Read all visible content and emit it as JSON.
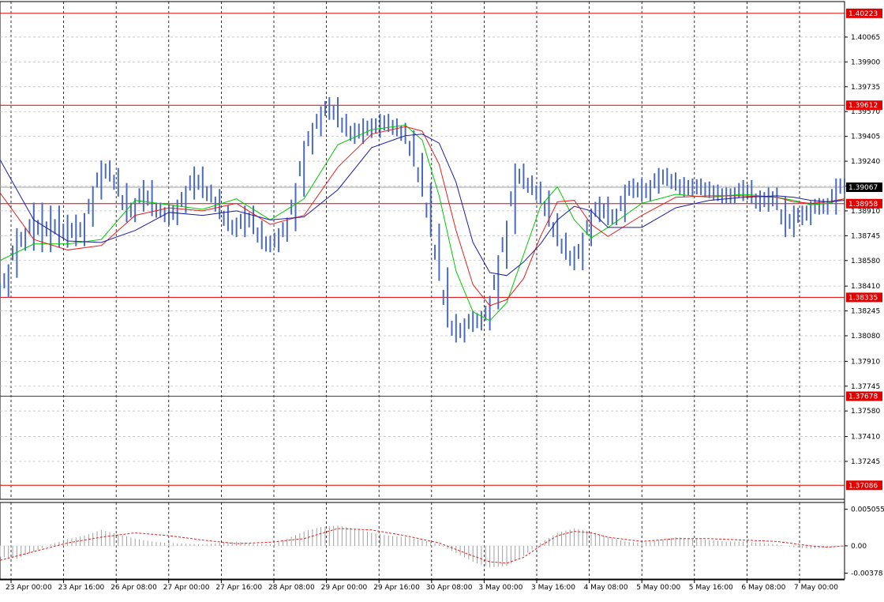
{
  "chart_data": {
    "type": "line",
    "main_panel": {
      "ylim": [
        1.36993,
        1.40301
      ],
      "y_ticks": [
        "1.40065",
        "1.39900",
        "1.39735",
        "1.39570",
        "1.39405",
        "1.39240",
        "1.39075",
        "1.38910",
        "1.38745",
        "1.38580",
        "1.38410",
        "1.38245",
        "1.38080",
        "1.37910",
        "1.37745",
        "1.37580",
        "1.37410",
        "1.37245"
      ],
      "current_price": "1.39067",
      "horizontal_levels": [
        "1.40223",
        "1.39612",
        "1.38958",
        "1.38335",
        "1.37678",
        "1.37086"
      ],
      "x_labels": [
        "23 Apr 00:00",
        "23 Apr 16:00",
        "26 Apr 08:00",
        "27 Apr 00:00",
        "27 Apr 16:00",
        "28 Apr 08:00",
        "29 Apr 00:00",
        "29 Apr 16:00",
        "30 Apr 08:00",
        "3 May 00:00",
        "3 May 16:00",
        "4 May 08:00",
        "5 May 00:00",
        "5 May 16:00",
        "6 May 08:00",
        "7 May 00:00"
      ],
      "price_series": {
        "name": "",
        "color": "#4a6bbf",
        "x": [
          0,
          2.5,
          5,
          7.5,
          10,
          12.5,
          15,
          17.5,
          20,
          22.5,
          25,
          27.5,
          30,
          32.5,
          35,
          37.5,
          40,
          42.5,
          45,
          47.5,
          50,
          52.5,
          55,
          57.5,
          60,
          62.5,
          65,
          67.5,
          70,
          72.5,
          75,
          77.5,
          80,
          82.5,
          85,
          87.5,
          90,
          92.5,
          95,
          97.5,
          100,
          102.5,
          105,
          107.5,
          110,
          112.5,
          115,
          117.5,
          120,
          122.5,
          125,
          127.5,
          130,
          132.5,
          135,
          137.5,
          140,
          142.5,
          145,
          147.5,
          150,
          152.5,
          155,
          157.5,
          160,
          162.5,
          165,
          167.5,
          170,
          172.5,
          175,
          177.5,
          180,
          182.5,
          185,
          187.5,
          190,
          192.5,
          195,
          197.5,
          200,
          202.5,
          205,
          207.5,
          210,
          212.5,
          215,
          217.5,
          220,
          222.5,
          225,
          227.5,
          230,
          232.5,
          235,
          237.5,
          240,
          242.5,
          245,
          247.5,
          250
        ],
        "y": [
          1.3838,
          1.3851,
          1.3875,
          1.3869,
          1.3892,
          1.3868,
          1.389,
          1.3871,
          1.3884,
          1.3872,
          1.3885,
          1.3903,
          1.392,
          1.3915,
          1.3905,
          1.3888,
          1.3895,
          1.3907,
          1.3892,
          1.3891,
          1.3886,
          1.3894,
          1.3903,
          1.3916,
          1.3904,
          1.3901,
          1.389,
          1.3882,
          1.3878,
          1.389,
          1.388,
          1.387,
          1.3868,
          1.3875,
          1.3882,
          1.3905,
          1.3933,
          1.3945,
          1.3956,
          1.3962,
          1.3951,
          1.3945,
          1.394,
          1.3948,
          1.3944,
          1.3951,
          1.3948,
          1.3945,
          1.394,
          1.3925,
          1.3905,
          1.3878,
          1.3849,
          1.3818,
          1.3808,
          1.3815,
          1.382,
          1.3816,
          1.383,
          1.3857,
          1.388,
          1.3918,
          1.391,
          1.3906,
          1.39,
          1.3885,
          1.3872,
          1.3863,
          1.3856,
          1.3872,
          1.3888,
          1.3896,
          1.3886,
          1.3888,
          1.3904,
          1.3908,
          1.3902,
          1.3907,
          1.3915,
          1.3912,
          1.3909,
          1.3905,
          1.3908,
          1.3906,
          1.3904,
          1.3902,
          1.39,
          1.3902,
          1.3907,
          1.39,
          1.3895,
          1.3902,
          1.3896,
          1.3878,
          1.389,
          1.3886,
          1.3893,
          1.3895,
          1.3893,
          1.3908,
          1.3907
        ]
      },
      "ma_series": [
        {
          "name": "",
          "color": "#00c800",
          "x": [
            0,
            10,
            20,
            30,
            40,
            50,
            60,
            70,
            80,
            90,
            100,
            110,
            120,
            125,
            130,
            135,
            140,
            145,
            150,
            155,
            160,
            165,
            170,
            175,
            180,
            190,
            200,
            210,
            220,
            230,
            235,
            240,
            245,
            250
          ],
          "y": [
            1.3858,
            1.3869,
            1.3869,
            1.3872,
            1.3898,
            1.3895,
            1.3892,
            1.3899,
            1.3885,
            1.3899,
            1.3935,
            1.3945,
            1.3948,
            1.3938,
            1.3901,
            1.3851,
            1.3824,
            1.3818,
            1.383,
            1.3862,
            1.3894,
            1.3907,
            1.3885,
            1.3873,
            1.388,
            1.3896,
            1.3902,
            1.39,
            1.3902,
            1.39,
            1.3898,
            1.3895,
            1.3896,
            1.3899
          ]
        },
        {
          "name": "",
          "color": "#e02020",
          "x": [
            0,
            10,
            20,
            30,
            40,
            50,
            60,
            70,
            80,
            90,
            100,
            110,
            120,
            125,
            130,
            135,
            140,
            145,
            150,
            155,
            160,
            165,
            170,
            175,
            180,
            190,
            200,
            210,
            220,
            230,
            235,
            240,
            245,
            250
          ],
          "y": [
            1.3903,
            1.3872,
            1.3865,
            1.3868,
            1.3888,
            1.3893,
            1.3891,
            1.3896,
            1.3882,
            1.3888,
            1.392,
            1.3942,
            1.3947,
            1.3944,
            1.3922,
            1.3878,
            1.3842,
            1.3828,
            1.3832,
            1.3846,
            1.3874,
            1.3897,
            1.3898,
            1.3882,
            1.3874,
            1.3888,
            1.39,
            1.3901,
            1.3901,
            1.39,
            1.3897,
            1.3896,
            1.3897,
            1.3899
          ]
        },
        {
          "name": "",
          "color": "#1c1ca6",
          "x": [
            0,
            10,
            20,
            30,
            40,
            50,
            60,
            70,
            80,
            90,
            100,
            110,
            120,
            125,
            130,
            135,
            140,
            145,
            150,
            155,
            160,
            165,
            170,
            175,
            180,
            190,
            200,
            210,
            220,
            230,
            235,
            240,
            245,
            250
          ],
          "y": [
            1.3925,
            1.3885,
            1.3871,
            1.387,
            1.3878,
            1.389,
            1.3888,
            1.3891,
            1.3885,
            1.3887,
            1.3905,
            1.3933,
            1.3941,
            1.3942,
            1.3936,
            1.391,
            1.387,
            1.385,
            1.3848,
            1.3857,
            1.3869,
            1.3885,
            1.3894,
            1.3891,
            1.388,
            1.388,
            1.3893,
            1.3898,
            1.39,
            1.3901,
            1.39,
            1.3898,
            1.3897,
            1.3898
          ]
        }
      ]
    },
    "oscillator_panel": {
      "ylim": [
        -0.0046,
        0.006
      ],
      "y_ticks": [
        "0.005055",
        "0.00",
        "-0.00378"
      ],
      "histogram": {
        "color": "#a0a0a0",
        "x": [
          0,
          5,
          10,
          15,
          20,
          25,
          30,
          35,
          40,
          45,
          50,
          55,
          60,
          65,
          70,
          75,
          80,
          85,
          90,
          95,
          100,
          105,
          110,
          115,
          120,
          125,
          130,
          135,
          140,
          145,
          150,
          155,
          160,
          165,
          170,
          175,
          180,
          185,
          190,
          195,
          200,
          205,
          210,
          215,
          220,
          225,
          230,
          235,
          240,
          245,
          250
        ],
        "y": [
          -0.0015,
          -0.0018,
          -0.0008,
          0.0002,
          0.0009,
          0.0014,
          0.0022,
          0.0016,
          0.001,
          0.0006,
          0.0004,
          0.0003,
          0.0002,
          0.0004,
          0.0006,
          0.0003,
          0.0002,
          0.001,
          0.002,
          0.0026,
          0.0028,
          0.0024,
          0.0018,
          0.0014,
          0.0012,
          0.0008,
          0.0002,
          -0.001,
          -0.0022,
          -0.003,
          -0.0028,
          -0.0014,
          0.0004,
          0.0018,
          0.0024,
          0.002,
          0.0012,
          0.0006,
          0.0004,
          0.0008,
          0.0012,
          0.001,
          0.0008,
          0.0006,
          0.0006,
          0.0004,
          0.0002,
          -0.0002,
          -0.0004,
          -0.0002,
          0.0
        ]
      },
      "signal_line": {
        "color": "#e02020",
        "x": [
          0,
          10,
          20,
          30,
          40,
          50,
          60,
          70,
          80,
          90,
          100,
          110,
          120,
          130,
          140,
          145,
          150,
          155,
          160,
          165,
          170,
          175,
          180,
          190,
          200,
          210,
          220,
          230,
          240,
          245,
          250
        ],
        "y": [
          -0.002,
          -0.0008,
          0.0004,
          0.0012,
          0.0018,
          0.0014,
          0.0008,
          0.0003,
          0.0005,
          0.001,
          0.0024,
          0.0022,
          0.0014,
          0.0004,
          -0.0014,
          -0.0022,
          -0.0024,
          -0.0016,
          0.0,
          0.0014,
          0.002,
          0.0018,
          0.0012,
          0.0006,
          0.001,
          0.001,
          0.0008,
          0.0006,
          0.0,
          -0.0002,
          0.0
        ]
      }
    },
    "grid": true
  }
}
